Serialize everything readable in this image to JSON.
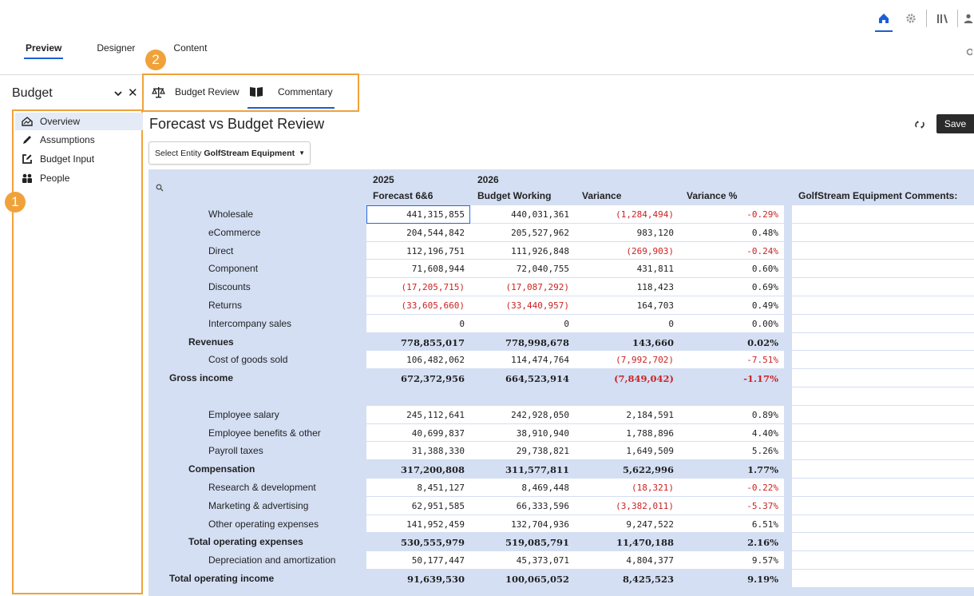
{
  "top_icons": [
    "home-icon",
    "gear-icon",
    "library-icon",
    "user-icon"
  ],
  "mode_tabs": [
    {
      "label": "Preview",
      "active": true
    },
    {
      "label": "Designer",
      "active": false
    },
    {
      "label": "Content",
      "active": false
    }
  ],
  "callouts": [
    "1",
    "2"
  ],
  "left_panel": {
    "title": "Budget",
    "items": [
      {
        "label": "Overview",
        "icon": "house-chart-icon",
        "selected": true
      },
      {
        "label": "Assumptions",
        "icon": "pencil-icon",
        "selected": false
      },
      {
        "label": "Budget Input",
        "icon": "edit-box-icon",
        "selected": false
      },
      {
        "label": "People",
        "icon": "people-icon",
        "selected": false
      }
    ]
  },
  "report_tabs": [
    {
      "label": "Budget Review",
      "icon": "scales-icon",
      "active": false
    },
    {
      "label": "Commentary",
      "icon": "open-book-icon",
      "active": true
    }
  ],
  "page_title": "Forecast vs Budget Review",
  "save_label": "Save",
  "entity": {
    "label": "Select Entity",
    "value": "GolfStream Equipment"
  },
  "grid": {
    "header_years": [
      "2025",
      "2026"
    ],
    "columns": [
      "Forecast 6&6",
      "Budget Working",
      "Variance",
      "Variance %",
      "GolfStream Equipment Comments:"
    ],
    "rows": [
      {
        "label": "Wholesale",
        "level": 2,
        "values": [
          "441,315,855",
          "440,031,361",
          "(1,284,494)",
          "-0.29%"
        ],
        "neg": [
          false,
          false,
          true,
          true
        ]
      },
      {
        "label": "eCommerce",
        "level": 2,
        "values": [
          "204,544,842",
          "205,527,962",
          "983,120",
          "0.48%"
        ],
        "neg": [
          false,
          false,
          false,
          false
        ]
      },
      {
        "label": "Direct",
        "level": 2,
        "values": [
          "112,196,751",
          "111,926,848",
          "(269,903)",
          "-0.24%"
        ],
        "neg": [
          false,
          false,
          true,
          true
        ]
      },
      {
        "label": "Component",
        "level": 2,
        "values": [
          "71,608,944",
          "72,040,755",
          "431,811",
          "0.60%"
        ],
        "neg": [
          false,
          false,
          false,
          false
        ]
      },
      {
        "label": "Discounts",
        "level": 2,
        "values": [
          "(17,205,715)",
          "(17,087,292)",
          "118,423",
          "0.69%"
        ],
        "neg": [
          true,
          true,
          false,
          false
        ]
      },
      {
        "label": "Returns",
        "level": 2,
        "values": [
          "(33,605,660)",
          "(33,440,957)",
          "164,703",
          "0.49%"
        ],
        "neg": [
          true,
          true,
          false,
          false
        ]
      },
      {
        "label": "Intercompany sales",
        "level": 2,
        "values": [
          "0",
          "0",
          "0",
          "0.00%"
        ],
        "neg": [
          false,
          false,
          false,
          false
        ]
      },
      {
        "label": "Revenues",
        "level": 1,
        "total": true,
        "values": [
          "778,855,017",
          "778,998,678",
          "143,660",
          "0.02%"
        ],
        "neg": [
          false,
          false,
          false,
          false
        ]
      },
      {
        "label": "Cost of goods sold",
        "level": 2,
        "values": [
          "106,482,062",
          "114,474,764",
          "(7,992,702)",
          "-7.51%"
        ],
        "neg": [
          false,
          false,
          true,
          true
        ]
      },
      {
        "label": "Gross income",
        "level": 0,
        "total": true,
        "values": [
          "672,372,956",
          "664,523,914",
          "(7,849,042)",
          "-1.17%"
        ],
        "neg": [
          false,
          false,
          true,
          true
        ]
      },
      {
        "label": "",
        "level": 2,
        "blank": true,
        "values": [
          "",
          "",
          "",
          ""
        ],
        "neg": [
          false,
          false,
          false,
          false
        ]
      },
      {
        "label": "Employee salary",
        "level": 2,
        "values": [
          "245,112,641",
          "242,928,050",
          "2,184,591",
          "0.89%"
        ],
        "neg": [
          false,
          false,
          false,
          false
        ]
      },
      {
        "label": "Employee benefits & other",
        "level": 2,
        "values": [
          "40,699,837",
          "38,910,940",
          "1,788,896",
          "4.40%"
        ],
        "neg": [
          false,
          false,
          false,
          false
        ]
      },
      {
        "label": "Payroll taxes",
        "level": 2,
        "values": [
          "31,388,330",
          "29,738,821",
          "1,649,509",
          "5.26%"
        ],
        "neg": [
          false,
          false,
          false,
          false
        ]
      },
      {
        "label": "Compensation",
        "level": 1,
        "total": true,
        "values": [
          "317,200,808",
          "311,577,811",
          "5,622,996",
          "1.77%"
        ],
        "neg": [
          false,
          false,
          false,
          false
        ]
      },
      {
        "label": "Research & development",
        "level": 2,
        "values": [
          "8,451,127",
          "8,469,448",
          "(18,321)",
          "-0.22%"
        ],
        "neg": [
          false,
          false,
          true,
          true
        ]
      },
      {
        "label": "Marketing & advertising",
        "level": 2,
        "values": [
          "62,951,585",
          "66,333,596",
          "(3,382,011)",
          "-5.37%"
        ],
        "neg": [
          false,
          false,
          true,
          true
        ]
      },
      {
        "label": "Other operating expenses",
        "level": 2,
        "values": [
          "141,952,459",
          "132,704,936",
          "9,247,522",
          "6.51%"
        ],
        "neg": [
          false,
          false,
          false,
          false
        ]
      },
      {
        "label": "Total operating expenses",
        "level": 1,
        "total": true,
        "values": [
          "530,555,979",
          "519,085,791",
          "11,470,188",
          "2.16%"
        ],
        "neg": [
          false,
          false,
          false,
          false
        ]
      },
      {
        "label": "Depreciation and amortization",
        "level": 2,
        "values": [
          "50,177,447",
          "45,373,071",
          "4,804,377",
          "9.57%"
        ],
        "neg": [
          false,
          false,
          false,
          false
        ]
      },
      {
        "label": "Total operating income",
        "level": 0,
        "total": true,
        "values": [
          "91,639,530",
          "100,065,052",
          "8,425,523",
          "9.19%"
        ],
        "neg": [
          false,
          false,
          false,
          false
        ]
      }
    ]
  },
  "colors": {
    "accent": "#1a5fd6",
    "callout": "#f0a23a",
    "grid_bg": "#d4dff4",
    "negative": "#c22222",
    "selected_nav": "#e4ebf7"
  }
}
